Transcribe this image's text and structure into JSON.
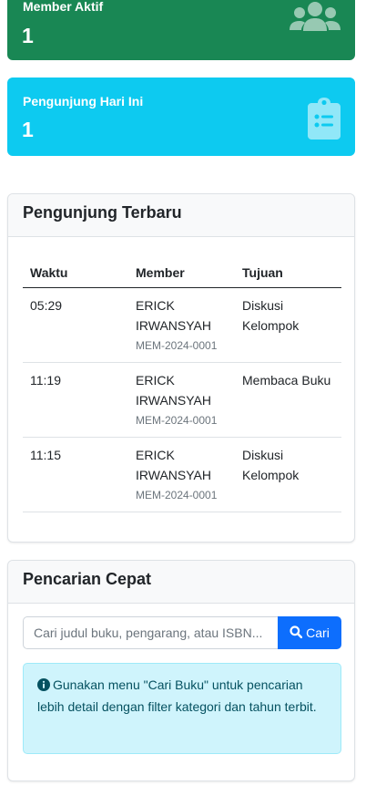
{
  "stats": {
    "members": {
      "label": "Member Aktif",
      "value": "1",
      "icon": "users-icon"
    },
    "visitors": {
      "label": "Pengunjung Hari Ini",
      "value": "1",
      "icon": "clipboard-list-icon"
    }
  },
  "recent": {
    "title": "Pengunjung Terbaru",
    "columns": [
      "Waktu",
      "Member",
      "Tujuan"
    ],
    "rows": [
      {
        "time": "05:29",
        "member": "ERICK IRWANSYAH",
        "code": "MEM-2024-0001",
        "purpose": "Diskusi Kelompok"
      },
      {
        "time": "11:19",
        "member": "ERICK IRWANSYAH",
        "code": "MEM-2024-0001",
        "purpose": "Membaca Buku"
      },
      {
        "time": "11:15",
        "member": "ERICK IRWANSYAH",
        "code": "MEM-2024-0001",
        "purpose": "Diskusi Kelompok"
      }
    ]
  },
  "quick_search": {
    "title": "Pencarian Cepat",
    "placeholder": "Cari judul buku, pengarang, atau ISBN...",
    "button_label": "Cari",
    "info": "Gunakan menu \"Cari Buku\" untuk pencarian lebih detail dengan filter kategori dan tahun terbit."
  },
  "colors": {
    "success": "#198754",
    "info": "#0dcaf0",
    "primary": "#0d6efd",
    "alert_bg": "#cff4fc"
  }
}
